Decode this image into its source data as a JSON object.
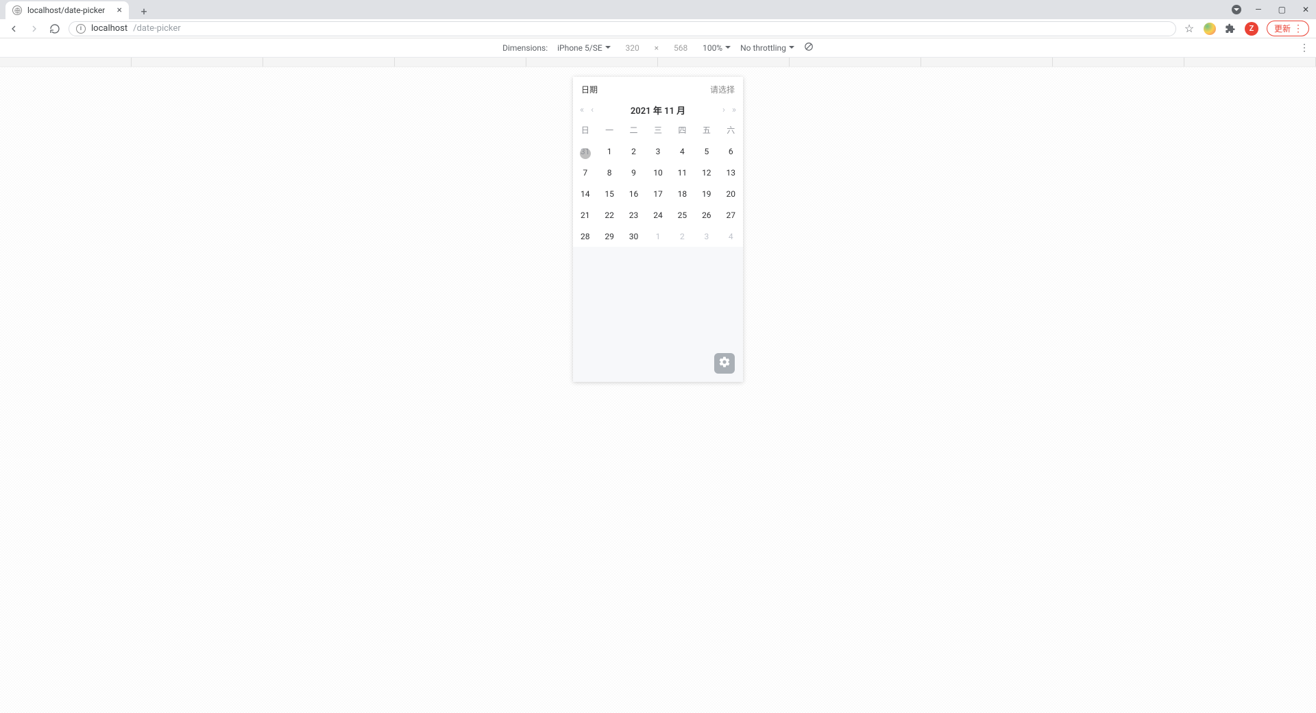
{
  "browser": {
    "tab_title": "localhost/date-picker",
    "url_host": "localhost",
    "url_path": "/date-picker",
    "update_label": "更新",
    "badge": "Z"
  },
  "devtools": {
    "dimensions_label": "Dimensions:",
    "device": "iPhone 5/SE",
    "width": "320",
    "height": "568",
    "zoom": "100%",
    "throttling": "No throttling"
  },
  "picker": {
    "label": "日期",
    "placeholder": "请选择",
    "title": "2021 年 11 月",
    "weekdays": [
      "日",
      "一",
      "二",
      "三",
      "四",
      "五",
      "六"
    ],
    "weeks": [
      [
        {
          "d": "31",
          "other": true
        },
        {
          "d": "1"
        },
        {
          "d": "2"
        },
        {
          "d": "3"
        },
        {
          "d": "4"
        },
        {
          "d": "5"
        },
        {
          "d": "6"
        }
      ],
      [
        {
          "d": "7"
        },
        {
          "d": "8"
        },
        {
          "d": "9"
        },
        {
          "d": "10"
        },
        {
          "d": "11"
        },
        {
          "d": "12"
        },
        {
          "d": "13"
        }
      ],
      [
        {
          "d": "14"
        },
        {
          "d": "15"
        },
        {
          "d": "16"
        },
        {
          "d": "17"
        },
        {
          "d": "18"
        },
        {
          "d": "19"
        },
        {
          "d": "20"
        }
      ],
      [
        {
          "d": "21"
        },
        {
          "d": "22"
        },
        {
          "d": "23"
        },
        {
          "d": "24"
        },
        {
          "d": "25"
        },
        {
          "d": "26"
        },
        {
          "d": "27"
        }
      ],
      [
        {
          "d": "28"
        },
        {
          "d": "29"
        },
        {
          "d": "30"
        },
        {
          "d": "1",
          "other": true
        },
        {
          "d": "2",
          "other": true
        },
        {
          "d": "3",
          "other": true
        },
        {
          "d": "4",
          "other": true
        }
      ]
    ],
    "touch_point": {
      "row": 0,
      "col": 0
    }
  }
}
